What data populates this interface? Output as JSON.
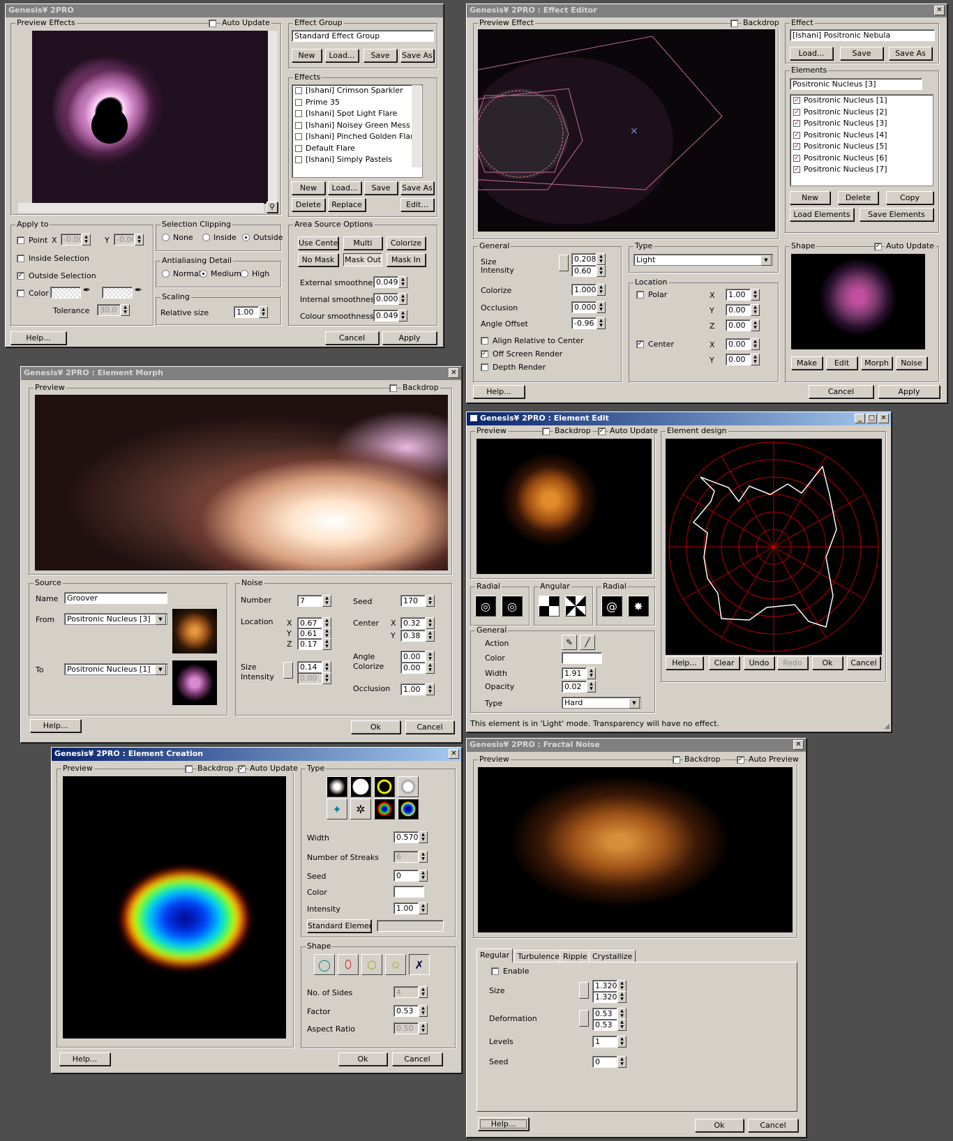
{
  "main": {
    "title": "Genesis¥ 2PRO",
    "preview_label": "Preview Effects",
    "auto_update": "Auto Update",
    "effect_group_label": "Effect Group",
    "effect_group_value": "Standard Effect Group",
    "btn_new": "New",
    "btn_load": "Load...",
    "btn_save": "Save",
    "btn_save_as": "Save As",
    "effects_label": "Effects",
    "effects": [
      "[Ishani] Crimson Sparkler",
      "Prime 35",
      "[Ishani] Spot Light Flare",
      "[Ishani] Noisey Green Mess",
      "[Ishani] Pinched Golden Flare",
      "Default Flare",
      "[Ishani] Simply Pastels"
    ],
    "btn_delete": "Delete",
    "btn_replace": "Replace",
    "btn_edit": "Edit...",
    "apply_to": "Apply to",
    "point": "Point",
    "x": "X",
    "y": "Y",
    "x_val": "-0.00",
    "y_val": "-0.00",
    "inside_sel": "Inside Selection",
    "outside_sel": "Outside Selection",
    "color": "Color",
    "tolerance": "Tolerance",
    "tol_val": "30.0",
    "sel_clip": "Selection Clipping",
    "none": "None",
    "inside": "Inside",
    "outside": "Outside",
    "aa": "Antialiasing Detail",
    "normal": "Normal",
    "medium": "Medium",
    "high": "High",
    "scaling": "Scaling",
    "rel_size": "Relative size",
    "rel_val": "1.00",
    "area": "Area Source Options",
    "use_center": "Use Center",
    "multi": "Multi",
    "colorize": "Colorize",
    "no_mask": "No Mask",
    "mask_out": "Mask Out",
    "mask_in": "Mask In",
    "ext": "External smoothness",
    "ext_v": "0.049",
    "int": "Internal smoothness",
    "int_v": "0.000",
    "col": "Colour smoothness",
    "col_v": "0.049",
    "help": "Help...",
    "cancel": "Cancel",
    "apply": "Apply"
  },
  "editor": {
    "title": "Genesis¥ 2PRO : Effect Editor",
    "preview": "Preview Effect",
    "backdrop": "Backdrop",
    "effect_label": "Effect",
    "effect_value": "[Ishani] Positronic Nebula",
    "load": "Load...",
    "save": "Save",
    "save_as": "Save As",
    "elements_label": "Elements",
    "elem_value": "Positronic Nucleus [3]",
    "elements": [
      "Positronic Nucleus [1]",
      "Positronic Nucleus [2]",
      "Positronic Nucleus [3]",
      "Positronic Nucleus [4]",
      "Positronic Nucleus [5]",
      "Positronic Nucleus [6]",
      "Positronic Nucleus [7]"
    ],
    "new": "New",
    "delete": "Delete",
    "copy": "Copy",
    "load_el": "Load Elements",
    "save_el": "Save Elements",
    "general": "General",
    "size": "Size",
    "intensity": "Intensity",
    "size_v": "0.208",
    "int_v": "0.60",
    "colorize": "Colorize",
    "colorize_v": "1.000",
    "occlusion": "Occlusion",
    "occ_v": "0.000",
    "angle": "Angle Offset",
    "angle_v": "-0.96",
    "align": "Align Relative to Center",
    "offscreen": "Off Screen Render",
    "depth": "Depth Render",
    "type": "Type",
    "type_v": "Light",
    "location": "Location",
    "polar": "Polar",
    "center": "Center",
    "x": "X",
    "y": "Y",
    "z": "Z",
    "px": "1.00",
    "py": "0.00",
    "pz": "0.00",
    "cx": "0.00",
    "cy": "0.00",
    "shape": "Shape",
    "auto_update": "Auto Update",
    "make": "Make",
    "edit": "Edit",
    "morph": "Morph",
    "noise": "Noise",
    "help": "Help...",
    "cancel": "Cancel",
    "apply": "Apply"
  },
  "morph": {
    "title": "Genesis¥ 2PRO : Element Morph",
    "preview": "Preview",
    "backdrop": "Backdrop",
    "source": "Source",
    "name": "Name",
    "name_v": "Groover",
    "from": "From",
    "from_v": "Positronic Nucleus [3]",
    "to": "To",
    "to_v": "Positronic Nucleus [1]",
    "noise": "Noise",
    "number": "Number",
    "number_v": "7",
    "seed": "Seed",
    "seed_v": "170",
    "location": "Location",
    "lx": "0.67",
    "ly": "0.61",
    "lz": "0.17",
    "x": "X",
    "y": "Y",
    "z": "Z",
    "center": "Center",
    "cx": "0.32",
    "cy": "0.38",
    "size": "Size",
    "intensity": "Intensity",
    "size_v": "0.14",
    "int_v": "0.00",
    "angle": "Angle",
    "colorize": "Colorize",
    "angle_v": "0.00",
    "colorize_v": "0.00",
    "occlusion": "Occlusion",
    "occ_v": "1.00",
    "help": "Help...",
    "ok": "Ok",
    "cancel": "Cancel"
  },
  "edit": {
    "title": "Genesis¥ 2PRO : Element Edit",
    "preview": "Preview",
    "backdrop": "Backdrop",
    "auto_update": "Auto Update",
    "design": "Element design",
    "radial": "Radial",
    "angular": "Angular",
    "general": "General",
    "action": "Action",
    "color": "Color",
    "width": "Width",
    "width_v": "1.91",
    "opacity": "Opacity",
    "opacity_v": "0.02",
    "type": "Type",
    "type_v": "Hard",
    "help": "Help...",
    "clear": "Clear",
    "undo": "Undo",
    "redo": "Redo",
    "ok": "Ok",
    "cancel": "Cancel",
    "status": "This element is in 'Light' mode. Transparency will have no effect."
  },
  "creation": {
    "title": "Genesis¥ 2PRO : Element Creation",
    "preview": "Preview",
    "backdrop": "Backdrop",
    "auto_update": "Auto Update",
    "type": "Type",
    "width": "Width",
    "width_v": "0.570",
    "streaks": "Number of Streaks",
    "streaks_v": "6",
    "seed": "Seed",
    "seed_v": "0",
    "color": "Color",
    "intensity": "Intensity",
    "intensity_v": "1.00",
    "std_el": "Standard Element",
    "shape": "Shape",
    "sides": "No. of Sides",
    "sides_v": "4",
    "factor": "Factor",
    "factor_v": "0.53",
    "aspect": "Aspect Ratio",
    "aspect_v": "0.50",
    "help": "Help...",
    "ok": "Ok",
    "cancel": "Cancel"
  },
  "fractal": {
    "title": "Genesis¥ 2PRO : Fractal Noise",
    "preview": "Preview",
    "backdrop": "Backdrop",
    "auto_preview": "Auto Preview",
    "tabs": [
      "Regular",
      "Turbulence",
      "Ripple",
      "Crystallize"
    ],
    "enable": "Enable",
    "size": "Size",
    "s1": "1.320",
    "s2": "1.320",
    "deformation": "Deformation",
    "d1": "0.53",
    "d2": "0.53",
    "levels": "Levels",
    "levels_v": "1",
    "seed": "Seed",
    "seed_v": "0",
    "help": "Help...",
    "ok": "Ok",
    "cancel": "Cancel"
  },
  "colors": {
    "titlebar_active": "#0a246a",
    "titlebar_inactive": "#808080",
    "face": "#d4d0c8",
    "desktop": "#4e4e4e"
  }
}
